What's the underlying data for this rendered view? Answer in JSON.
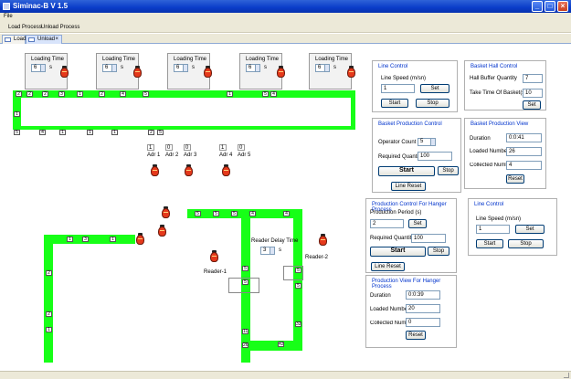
{
  "window": {
    "title": "Siminac-B V 1.5"
  },
  "menu": {
    "file": "File"
  },
  "toolbar": {
    "load_process": "Load Process",
    "unload_process": "Unload Process"
  },
  "tabs": [
    {
      "label": "Load"
    },
    {
      "label": "Unload"
    }
  ],
  "loading": {
    "label": "Loading Time",
    "unit": "s",
    "values": [
      "6",
      "6",
      "6",
      "6",
      "6"
    ]
  },
  "track": {
    "top_row": [
      "2",
      "2",
      "2",
      "3",
      "1",
      "2",
      "4",
      "5",
      "1",
      "5",
      "4"
    ],
    "bottom_row": [
      "5",
      "4",
      "1",
      "1",
      "1",
      "2",
      "5"
    ],
    "left_col": [
      "1"
    ]
  },
  "addresses": [
    {
      "label": "Adr 1",
      "value": "1"
    },
    {
      "label": "Adr 2",
      "value": "0"
    },
    {
      "label": "Adr 3",
      "value": "0"
    },
    {
      "label": "Adr 4",
      "value": "1"
    },
    {
      "label": "Adr 5",
      "value": "0"
    }
  ],
  "unload_track": {
    "top_row": [
      "5",
      "5",
      "5",
      "4",
      "4"
    ],
    "left_top": [
      "1",
      "3",
      "1"
    ],
    "left_col": [
      "2",
      "2",
      "1"
    ],
    "mid_col": [
      "5",
      "5",
      "11",
      "26"
    ],
    "right_col": [
      "5",
      "5",
      "32"
    ],
    "bottom_right": "42"
  },
  "reader_delay": {
    "label": "Reader Delay Time",
    "value": "3",
    "unit": "s"
  },
  "readers": {
    "reader1": "Reader-1",
    "reader2": "Reader-2"
  },
  "line_control": {
    "title": "Line Control",
    "speed_label": "Line Speed (m/sn)",
    "speed_value": "1",
    "set": "Set",
    "start": "Start",
    "stop": "Stop"
  },
  "basket_hall": {
    "title": "Basket Hall Control",
    "buffer_label": "Hall Buffer Quantity",
    "buffer_value": "7",
    "take_label": "Take Time Of Basket(s)",
    "take_value": "10",
    "set": "Set"
  },
  "basket_production": {
    "title": "Basket Production Control",
    "operator_label": "Operator Count",
    "operator_value": "5",
    "required_label": "Required Quantity",
    "required_value": "100",
    "start": "Start",
    "stop": "Stop",
    "line_reset": "Line Reset"
  },
  "basket_view": {
    "title": "Basket Production View",
    "duration_label": "Duration",
    "duration_value": "0:0:41",
    "loaded_label": "Loaded Number",
    "loaded_value": "26",
    "collected_label": "Collected Number",
    "collected_value": "4",
    "reset": "Reset"
  },
  "hanger_control": {
    "title": "Production Control For Hanger Process",
    "period_label": "Production Period (s)",
    "period_value": "2",
    "set": "Set",
    "required_label": "Required Quantity",
    "required_value": "100",
    "start": "Start",
    "stop": "Stop",
    "line_reset": "Line Reset"
  },
  "line_control2": {
    "title": "Line Control",
    "speed_label": "Line Speed (m/sn)",
    "speed_value": "1",
    "set": "Set",
    "start": "Start",
    "stop": "Stop"
  },
  "hanger_view": {
    "title": "Production View For Hanger Process",
    "duration_label": "Duration",
    "duration_value": "0:0:39",
    "loaded_label": "Loaded Number",
    "loaded_value": "20",
    "collected_label": "Collected Number",
    "collected_value": "0",
    "reset": "Reset"
  }
}
